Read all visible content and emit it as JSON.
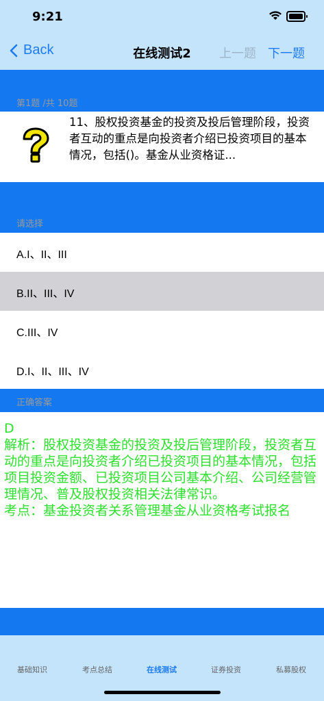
{
  "status": {
    "time": "9:21"
  },
  "nav": {
    "back_label": "Back",
    "title": "在线测试2",
    "prev_label": "上一题",
    "next_label": "下一题"
  },
  "question": {
    "counter": "第1题 /共 10题",
    "text": "11、股权投资基金的投资及投后管理阶段，投资者互动的重点是向投资者介绍已投资项目的基本情况，包括()。基金从业资格证..."
  },
  "options_header": "请选择",
  "options": [
    {
      "label": "A.I、II、III",
      "selected": false
    },
    {
      "label": "B.II、III、IV",
      "selected": true
    },
    {
      "label": "C.III、IV",
      "selected": false
    },
    {
      "label": "D.I、II、III、IV",
      "selected": false
    }
  ],
  "answer_header": "正确答案",
  "answer": {
    "letter": "D",
    "analysis": "解析：股权投资基金的投资及投后管理阶段，投资者互动的重点是向投资者介绍已投资项目的基本情况，包括项目投资金额、已投资项目公司基本介绍、公司经营管理情况、普及股权投资相关法律常识。",
    "point": "考点：基金投资者关系管理基金从业资格考试报名"
  },
  "tabs": [
    {
      "label": "基础知识",
      "active": false
    },
    {
      "label": "考点总结",
      "active": false
    },
    {
      "label": "在线测试",
      "active": true
    },
    {
      "label": "证券投资",
      "active": false
    },
    {
      "label": "私募股权",
      "active": false
    }
  ],
  "colors": {
    "accent": "#1e7bf5",
    "section_blue": "#1478f0",
    "bar_bg": "#c3e4fb",
    "answer_green": "#2ee02e",
    "selected_bg": "#d1d1d6"
  }
}
